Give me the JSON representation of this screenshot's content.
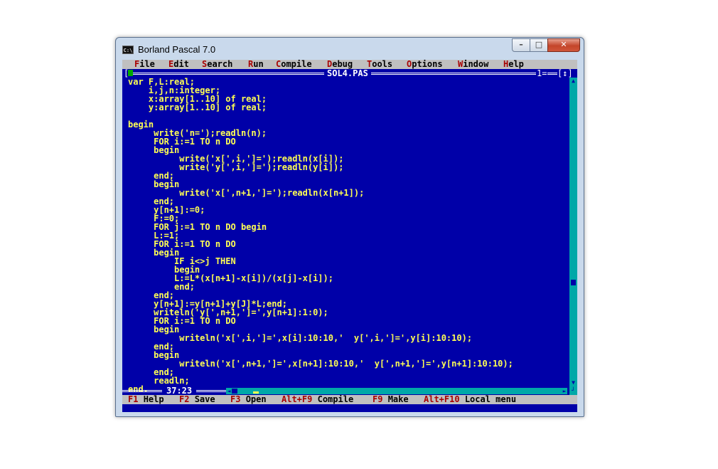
{
  "window": {
    "title": "Borland Pascal 7.0",
    "minimize": "–",
    "maximize": "□",
    "close": "✕"
  },
  "menu": [
    {
      "hk": "F",
      "rest": "ile"
    },
    {
      "hk": "E",
      "rest": "dit"
    },
    {
      "hk": "S",
      "rest": "earch"
    },
    {
      "hk": "R",
      "rest": "un"
    },
    {
      "hk": "C",
      "rest": "ompile"
    },
    {
      "hk": "D",
      "rest": "ebug"
    },
    {
      "hk": "T",
      "rest": "ools"
    },
    {
      "hk": "O",
      "rest": "ptions"
    },
    {
      "hk": "W",
      "rest": "indow"
    },
    {
      "hk": "H",
      "rest": "elp"
    }
  ],
  "editor": {
    "file_name": "SOL4.PAS",
    "window_number": "1=",
    "zoom_box": "[↕]",
    "cursor_position": "37:23",
    "code": "var F,L:real;\n    i,j,n:integer;\n    x:array[1..10] of real;\n    y:array[1..10] of real;\n\nbegin\n     write('n=');readln(n);\n     FOR i:=1 TO n DO\n     begin\n          write('x[',i,']=');readln(x[i]);\n          write('y[',i,']=');readln(y[i]);\n     end;\n     begin\n          write('x[',n+1,']=');readln(x[n+1]);\n     end;\n     y[n+1]:=0;\n     F:=0;\n     FOR j:=1 TO n DO begin\n     L:=1;\n     FOR i:=1 TO n DO\n     begin\n         IF i<>j THEN\n         begin\n         L:=L*(x[n+1]-x[i])/(x[j]-x[i]);\n         end;\n     end;\n     y[n+1]:=y[n+1]+y[J]*L;end;\n     writeln('y[',n+1,']=',y[n+1]:1:0);\n     FOR i:=1 TO n DO\n     begin\n          writeln('x[',i,']=',x[i]:10:10,'  y[',i,']=',y[i]:10:10);\n     end;\n     begin\n          writeln('x[',n+1,']=',x[n+1]:10:10,'  y[',n+1,']=',y[n+1]:10:10);\n     end;\n     readln;\nend."
  },
  "status": [
    {
      "key": "F1",
      "label": "Help"
    },
    {
      "key": "F2",
      "label": "Save"
    },
    {
      "key": "F3",
      "label": "Open"
    },
    {
      "key": "Alt+F9",
      "label": "Compile"
    },
    {
      "key": "F9",
      "label": "Make"
    },
    {
      "key": "Alt+F10",
      "label": "Local menu"
    }
  ]
}
